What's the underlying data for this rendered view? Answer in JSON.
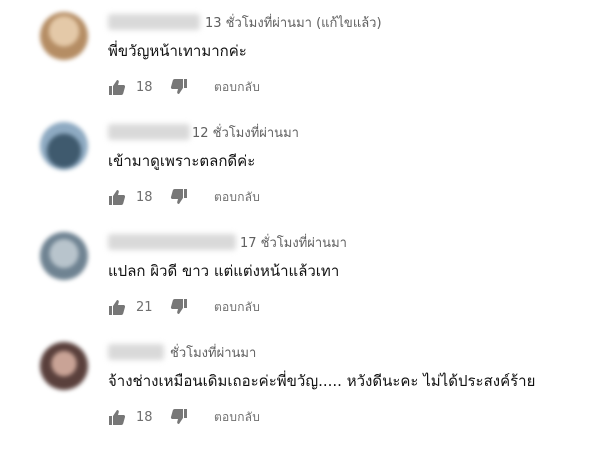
{
  "comments": [
    {
      "avatar_color": "#c9a27a",
      "time": "13 ชั่วโมงที่ผ่านมา (แก้ไขแล้ว)",
      "text": "พี่ขวัญหน้าเทามากค่ะ",
      "likes": "18",
      "reply_label": "ตอบกลับ",
      "like_icon": "thumbs-up-icon",
      "dislike_icon": "thumbs-down-icon"
    },
    {
      "avatar_color": "#5f7d96",
      "time": "12 ชั่วโมงที่ผ่านมา",
      "text": "เข้ามาดูเพราะตลกดีค่ะ",
      "likes": "18",
      "reply_label": "ตอบกลับ",
      "like_icon": "thumbs-up-icon",
      "dislike_icon": "thumbs-down-icon"
    },
    {
      "avatar_color": "#8fa0ad",
      "time": "17 ชั่วโมงที่ผ่านมา",
      "text": "แปลก ผิวดี ขาว แต่แต่งหน้าแล้วเทา",
      "likes": "21",
      "reply_label": "ตอบกลับ",
      "like_icon": "thumbs-up-icon",
      "dislike_icon": "thumbs-down-icon"
    },
    {
      "avatar_color": "#7a5a55",
      "time": "ชั่วโมงที่ผ่านมา",
      "text": "จ้างช่างเหมือนเดิมเถอะค่ะพี่ขวัญ..... หวังดีนะคะ ไม่ได้ประสงค์ร้าย",
      "likes": "18",
      "reply_label": "ตอบกลับ",
      "like_icon": "thumbs-up-icon",
      "dislike_icon": "thumbs-down-icon"
    }
  ]
}
